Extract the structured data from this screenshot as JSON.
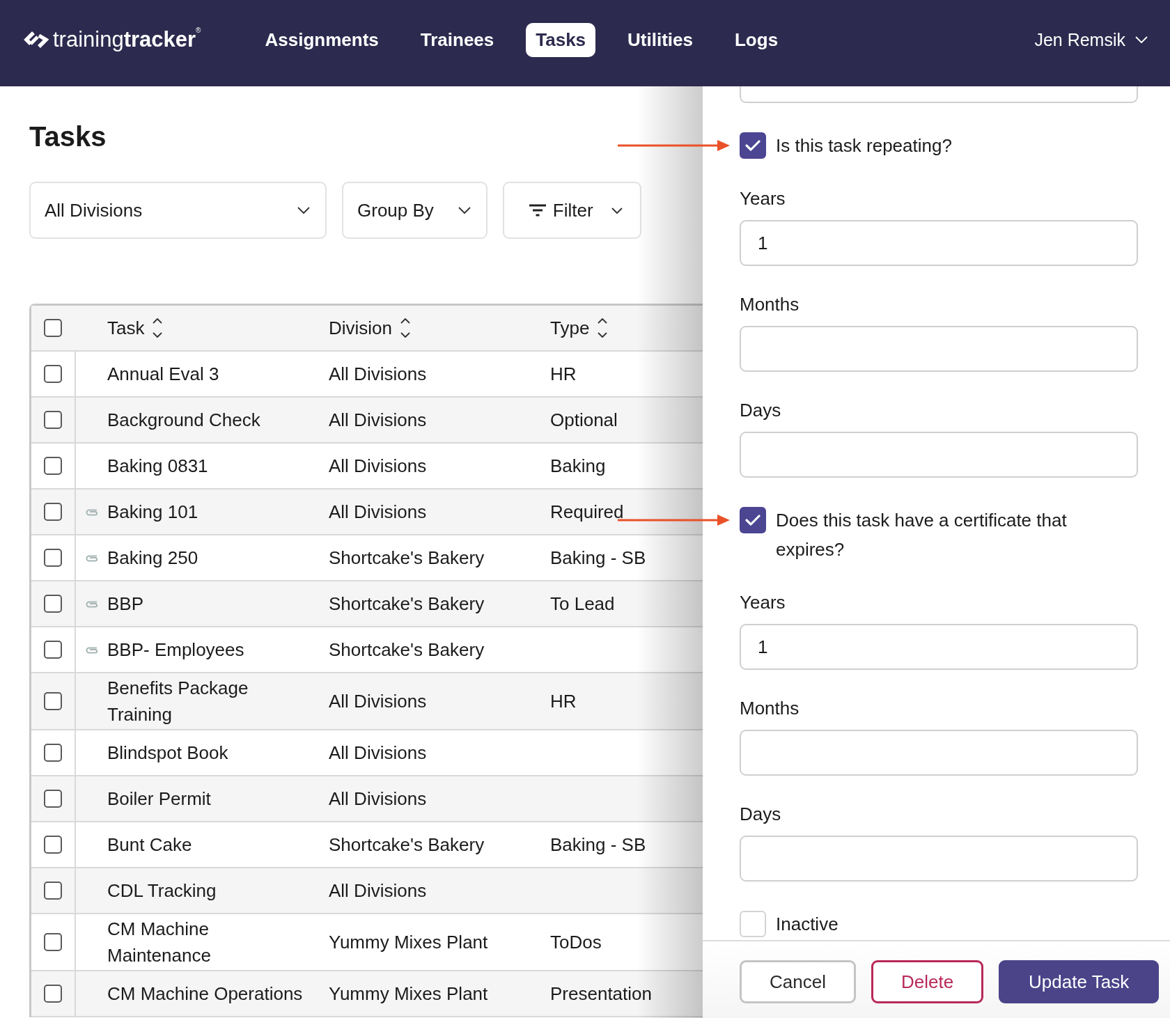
{
  "header": {
    "logo": "training**tracker**$^{®}$",
    "nav": [
      {
        "label": "Assignments",
        "selected": false
      },
      {
        "label": "Trainees",
        "selected": false
      },
      {
        "label": "Tasks",
        "selected": true
      },
      {
        "label": "Utilities",
        "selected": false
      },
      {
        "label": "Logs",
        "selected": false
      }
    ],
    "user": "Jen Remsik"
  },
  "page": {
    "title": "Tasks",
    "filters": [
      {
        "kind": "select",
        "label": "All Divisions"
      },
      {
        "kind": "select",
        "label": "Group By"
      },
      {
        "kind": "filter",
        "label": "Filter"
      }
    ]
  },
  "table": {
    "select_all": {
      "checked": false
    },
    "columns": [
      {
        "label": "Task",
        "sortable": true
      },
      {
        "label": "Division",
        "sortable": true
      },
      {
        "label": "Type",
        "sortable": true
      }
    ],
    "rows": [
      {
        "checked": false,
        "attachment": false,
        "task": "Annual Eval 3",
        "division": "All Divisions",
        "type": "HR"
      },
      {
        "checked": false,
        "attachment": false,
        "task": "Background Check",
        "division": "All Divisions",
        "type": "Optional"
      },
      {
        "checked": false,
        "attachment": false,
        "task": "Baking 0831",
        "division": "All Divisions",
        "type": "Baking"
      },
      {
        "checked": false,
        "attachment": true,
        "task": "Baking 101",
        "division": "All Divisions",
        "type": "Required"
      },
      {
        "checked": false,
        "attachment": true,
        "task": "Baking 250",
        "division": "Shortcake's Bakery",
        "type": "Baking - SB"
      },
      {
        "checked": false,
        "attachment": true,
        "task": "BBP",
        "division": "Shortcake's Bakery",
        "type": "To Lead"
      },
      {
        "checked": false,
        "attachment": true,
        "task": "BBP- Employees",
        "division": "Shortcake's Bakery"
      },
      {
        "checked": false,
        "attachment": false,
        "task": "Benefits Package Training",
        "division": "All Divisions",
        "type": "HR"
      },
      {
        "checked": false,
        "attachment": false,
        "task": "Blindspot Book",
        "division": "All Divisions"
      },
      {
        "checked": false,
        "attachment": false,
        "task": "Boiler Permit",
        "division": "All Divisions"
      },
      {
        "checked": false,
        "attachment": false,
        "task": "Bunt Cake",
        "division": "Shortcake's Bakery",
        "type": "Baking - SB"
      },
      {
        "checked": false,
        "attachment": false,
        "task": "CDL Tracking",
        "division": "All Divisions"
      },
      {
        "checked": false,
        "attachment": false,
        "task": "CM Machine Maintenance",
        "division": "Yummy Mixes Plant",
        "type": "ToDos"
      },
      {
        "checked": false,
        "attachment": false,
        "task": "CM Machine Operations",
        "division": "Yummy Mixes Plant",
        "type": "Presentation"
      }
    ]
  },
  "side_panel": {
    "items": [
      {
        "kind": "clipped"
      },
      {
        "kind": "checkbox",
        "label": "Is this task repeating?",
        "checked": true,
        "arrow": true
      },
      {
        "kind": "field",
        "label": "Years",
        "value": "1"
      },
      {
        "kind": "field",
        "label": "Months"
      },
      {
        "kind": "field",
        "label": "Days"
      },
      {
        "kind": "checkbox",
        "label": "Does this task have a certificate that expires?",
        "checked": true,
        "arrow": true
      },
      {
        "kind": "field",
        "label": "Years",
        "value": "1"
      },
      {
        "kind": "field",
        "label": "Months"
      },
      {
        "kind": "field",
        "label": "Days"
      },
      {
        "kind": "checkbox",
        "label": "Inactive",
        "checked": false,
        "arrow": false
      }
    ],
    "buttons": [
      {
        "kind": "secondary",
        "label": "Cancel"
      },
      {
        "kind": "danger",
        "label": "Delete"
      },
      {
        "kind": "primary",
        "label": "Update Task"
      }
    ]
  }
}
